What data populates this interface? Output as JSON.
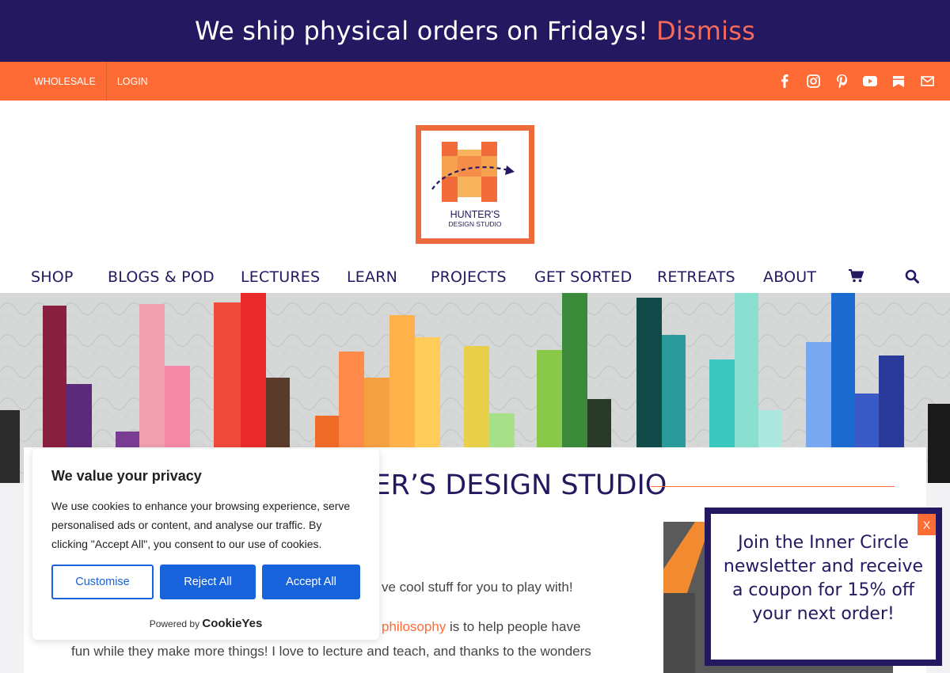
{
  "announcement": {
    "text": "We ship physical orders on Fridays!",
    "dismiss_label": "Dismiss"
  },
  "topbar": {
    "links": [
      "WHOLESALE",
      "LOGIN"
    ],
    "social_icons": [
      "facebook-icon",
      "instagram-icon",
      "pinterest-icon",
      "youtube-icon",
      "bookmark-icon",
      "mail-icon"
    ]
  },
  "logo": {
    "line1": "HUNTER'S",
    "line2": "DESIGN STUDIO"
  },
  "nav": {
    "items": [
      "SHOP",
      "BLOGS & POD",
      "LECTURES",
      "LEARN",
      "PROJECTS",
      "GET SORTED",
      "RETREATS",
      "ABOUT"
    ],
    "icons": [
      "cart-icon",
      "search-icon"
    ]
  },
  "content": {
    "title": "TER’S DESIGN STUDIO",
    "p1": "ve cool stuff for you to play with!",
    "p2_link": "philosophy",
    "p2_rest": " is to help people have",
    "p3": "fun while they make more things! I love to lecture and teach, and thanks to the wonders"
  },
  "cookie": {
    "heading": "We value your privacy",
    "description": "We use cookies to enhance your browsing experience, serve personalised ads or content, and analyse our traffic. By clicking \"Accept All\", you consent to our use of cookies.",
    "customise_label": "Customise",
    "reject_label": "Reject All",
    "accept_label": "Accept All",
    "powered_by": "Powered by",
    "brand": "CookieYes"
  },
  "newsletter": {
    "text": "Join the Inner Circle newsletter and receive a coupon for 15% off your next order!",
    "close_label": "X"
  },
  "colors": {
    "navy": "#241860",
    "orange": "#ff6b35",
    "dismiss": "#f56a5a",
    "cookie_blue": "#1863dc"
  }
}
